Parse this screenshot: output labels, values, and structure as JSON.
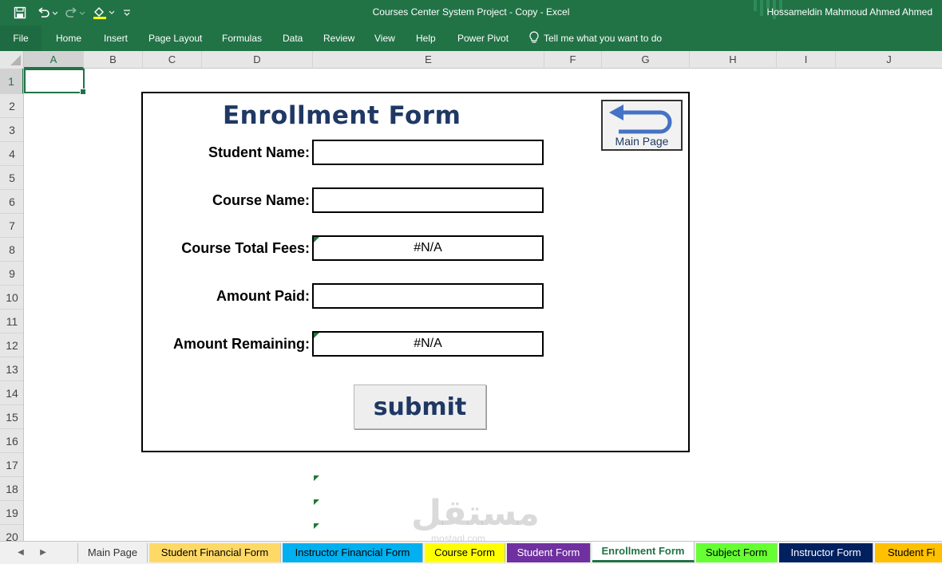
{
  "window": {
    "title": "Courses Center System Project - Copy  -  Excel",
    "user": "Hossameldin Mahmoud Ahmed Ahmed"
  },
  "ribbon": {
    "tabs": [
      "File",
      "Home",
      "Insert",
      "Page Layout",
      "Formulas",
      "Data",
      "Review",
      "View",
      "Help",
      "Power Pivot"
    ],
    "tell_me": "Tell me what you want to do"
  },
  "columns": [
    "A",
    "B",
    "C",
    "D",
    "E",
    "F",
    "G",
    "H",
    "I",
    "J"
  ],
  "rows": [
    "1",
    "2",
    "3",
    "4",
    "5",
    "6",
    "7",
    "8",
    "9",
    "10",
    "11",
    "12",
    "13",
    "14",
    "15",
    "16",
    "17",
    "18",
    "19",
    "20"
  ],
  "form": {
    "title": "Enrollment Form",
    "back_button_label": "Main Page",
    "fields": [
      {
        "label": "Student Name:",
        "value": ""
      },
      {
        "label": "Course Name:",
        "value": ""
      },
      {
        "label": "Course Total Fees:",
        "value": "#N/A"
      },
      {
        "label": "Amount Paid:",
        "value": ""
      },
      {
        "label": "Amount Remaining:",
        "value": "#N/A"
      }
    ],
    "submit_label": "submit"
  },
  "watermark": {
    "text": "مستقل",
    "subtext": "mostaql.com"
  },
  "sheet_tabs": [
    {
      "label": "Main Page",
      "color": "#f0f0f0",
      "active": false
    },
    {
      "label": "Student Financial Form",
      "color": "#ffd966",
      "active": false
    },
    {
      "label": "Instructor Financial Form",
      "color": "#00b0f0",
      "active": false
    },
    {
      "label": "Course Form",
      "color": "#ffff00",
      "active": false
    },
    {
      "label": "Student Form",
      "color": "#7030a0",
      "active": false
    },
    {
      "label": "Enrollment Form",
      "color": "#ffffff",
      "active": true
    },
    {
      "label": "Subject Form",
      "color": "#66ff33",
      "active": false
    },
    {
      "label": "Instructor Form",
      "color": "#002060",
      "active": false
    },
    {
      "label": "Student Fi",
      "color": "#ffc000",
      "active": false
    }
  ],
  "colors": {
    "excel_green": "#217346",
    "form_title": "#1f3864"
  }
}
